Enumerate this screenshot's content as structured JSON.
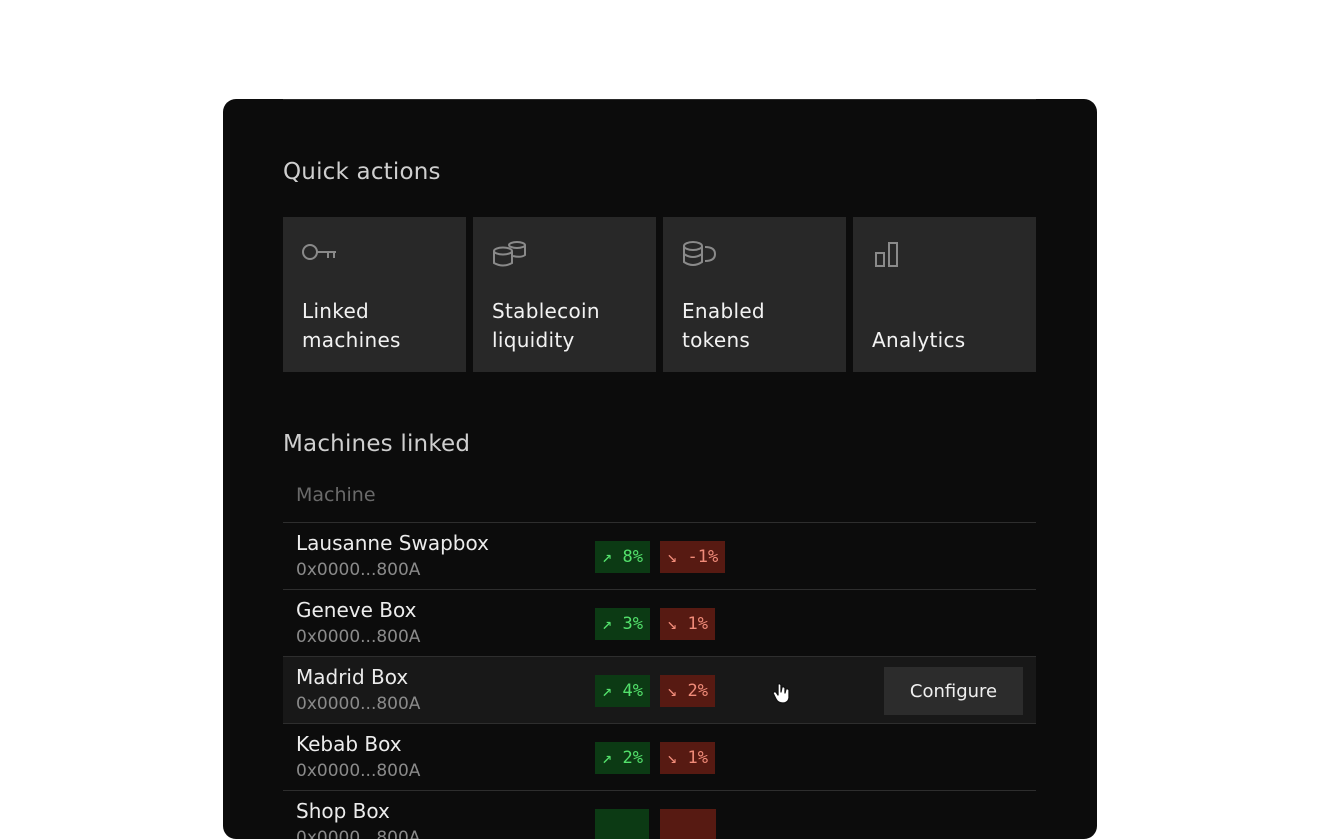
{
  "quick_actions": {
    "title": "Quick actions",
    "items": [
      {
        "line1": "Linked",
        "line2": "machines",
        "icon": "key-icon"
      },
      {
        "line1": "Stablecoin",
        "line2": "liquidity",
        "icon": "coin-stack-icon"
      },
      {
        "line1": "Enabled",
        "line2": "tokens",
        "icon": "coins-icon"
      },
      {
        "line1": "Analytics",
        "line2": "",
        "icon": "bar-chart-icon"
      }
    ]
  },
  "machines": {
    "title": "Machines linked",
    "column_header": "Machine",
    "configure_label": "Configure",
    "rows": [
      {
        "name": "Lausanne Swapbox",
        "address": "0x0000...800A",
        "up": "↗ 8%",
        "down": "↘ -1%"
      },
      {
        "name": "Geneve Box",
        "address": "0x0000...800A",
        "up": "↗ 3%",
        "down": "↘ 1%"
      },
      {
        "name": "Madrid Box",
        "address": "0x0000...800A",
        "up": "↗ 4%",
        "down": "↘ 2%"
      },
      {
        "name": "Kebab Box",
        "address": "0x0000...800A",
        "up": "↗ 2%",
        "down": "↘ 1%"
      },
      {
        "name": "Shop Box",
        "address": "0x0000...800A",
        "up": "",
        "down": ""
      }
    ]
  },
  "colors": {
    "panel_bg": "#0c0c0c",
    "card_bg": "#282828",
    "up_bg": "#0c3a14",
    "up_text": "#53e06b",
    "down_bg": "#571a12",
    "down_text": "#f08b79"
  }
}
